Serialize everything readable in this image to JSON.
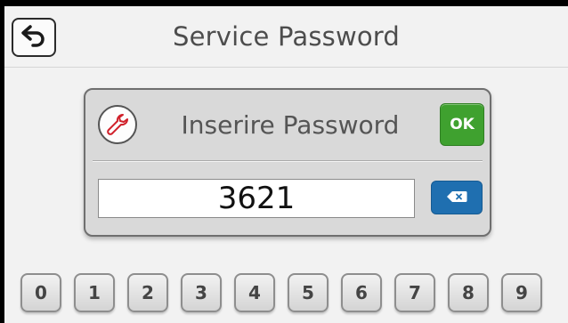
{
  "header": {
    "title": "Service Password",
    "back_icon": "back-arrow-icon"
  },
  "dialog": {
    "icon": "wrench-icon",
    "prompt": "Inserire Password",
    "ok_label": "OK",
    "password_value": "3621",
    "delete_icon": "backspace-icon"
  },
  "keypad": {
    "keys": [
      "0",
      "1",
      "2",
      "3",
      "4",
      "5",
      "6",
      "7",
      "8",
      "9"
    ]
  },
  "colors": {
    "ok": "#3fa12f",
    "delete": "#1f6fb0",
    "wrench": "#d0202a"
  }
}
